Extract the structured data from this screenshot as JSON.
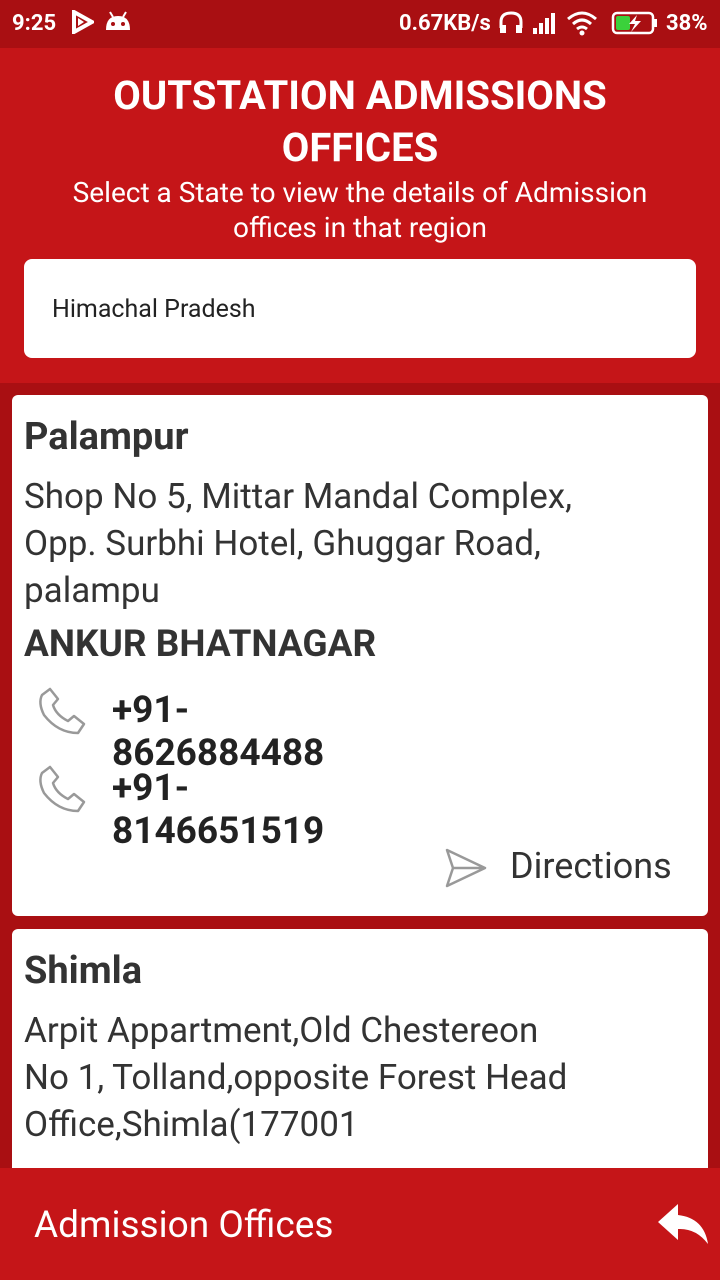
{
  "status_bar": {
    "time": "9:25",
    "network_speed": "0.67KB/s",
    "battery": "38%"
  },
  "header": {
    "title_line1": "OUTSTATION ADMISSIONS",
    "title_line2": "OFFICES",
    "subtitle_line1": "Select a State to view the details of Admission",
    "subtitle_line2": "offices in that region",
    "selected_state": "Himachal Pradesh"
  },
  "offices": [
    {
      "city": "Palampur",
      "address_lines": [
        "Shop No 5, Mittar Mandal Complex,",
        "Opp. Surbhi Hotel, Ghuggar Road,",
        "palampu"
      ],
      "contact_name": "ANKUR BHATNAGAR",
      "phones": [
        "+91-8626884488",
        "+91-8146651519"
      ],
      "directions_label": "Directions"
    },
    {
      "city": "Shimla",
      "address_lines": [
        "Arpit Appartment,Old Chestereon",
        "No 1, Tolland,opposite Forest Head",
        "Office,Shimla(177001"
      ]
    }
  ],
  "bottom_bar": {
    "title": "Admission Offices",
    "back_icon": "reply-arrow-icon"
  },
  "colors": {
    "primary": "#c51518",
    "dark": "#a90f12"
  }
}
